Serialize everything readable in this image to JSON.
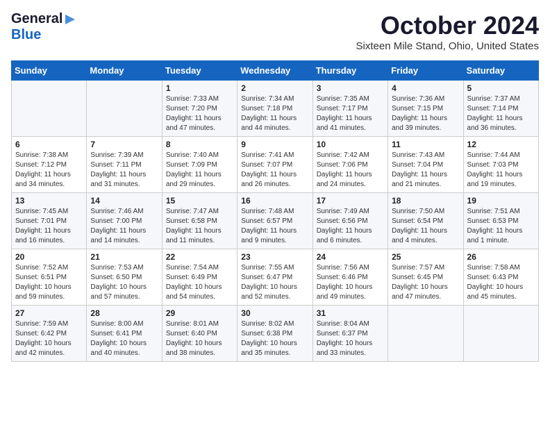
{
  "header": {
    "logo_general": "General",
    "logo_blue": "Blue",
    "calendar_title": "October 2024",
    "calendar_subtitle": "Sixteen Mile Stand, Ohio, United States"
  },
  "days_of_week": [
    "Sunday",
    "Monday",
    "Tuesday",
    "Wednesday",
    "Thursday",
    "Friday",
    "Saturday"
  ],
  "weeks": [
    [
      {
        "day": "",
        "sunrise": "",
        "sunset": "",
        "daylight": ""
      },
      {
        "day": "",
        "sunrise": "",
        "sunset": "",
        "daylight": ""
      },
      {
        "day": "1",
        "sunrise": "Sunrise: 7:33 AM",
        "sunset": "Sunset: 7:20 PM",
        "daylight": "Daylight: 11 hours and 47 minutes."
      },
      {
        "day": "2",
        "sunrise": "Sunrise: 7:34 AM",
        "sunset": "Sunset: 7:18 PM",
        "daylight": "Daylight: 11 hours and 44 minutes."
      },
      {
        "day": "3",
        "sunrise": "Sunrise: 7:35 AM",
        "sunset": "Sunset: 7:17 PM",
        "daylight": "Daylight: 11 hours and 41 minutes."
      },
      {
        "day": "4",
        "sunrise": "Sunrise: 7:36 AM",
        "sunset": "Sunset: 7:15 PM",
        "daylight": "Daylight: 11 hours and 39 minutes."
      },
      {
        "day": "5",
        "sunrise": "Sunrise: 7:37 AM",
        "sunset": "Sunset: 7:14 PM",
        "daylight": "Daylight: 11 hours and 36 minutes."
      }
    ],
    [
      {
        "day": "6",
        "sunrise": "Sunrise: 7:38 AM",
        "sunset": "Sunset: 7:12 PM",
        "daylight": "Daylight: 11 hours and 34 minutes."
      },
      {
        "day": "7",
        "sunrise": "Sunrise: 7:39 AM",
        "sunset": "Sunset: 7:11 PM",
        "daylight": "Daylight: 11 hours and 31 minutes."
      },
      {
        "day": "8",
        "sunrise": "Sunrise: 7:40 AM",
        "sunset": "Sunset: 7:09 PM",
        "daylight": "Daylight: 11 hours and 29 minutes."
      },
      {
        "day": "9",
        "sunrise": "Sunrise: 7:41 AM",
        "sunset": "Sunset: 7:07 PM",
        "daylight": "Daylight: 11 hours and 26 minutes."
      },
      {
        "day": "10",
        "sunrise": "Sunrise: 7:42 AM",
        "sunset": "Sunset: 7:06 PM",
        "daylight": "Daylight: 11 hours and 24 minutes."
      },
      {
        "day": "11",
        "sunrise": "Sunrise: 7:43 AM",
        "sunset": "Sunset: 7:04 PM",
        "daylight": "Daylight: 11 hours and 21 minutes."
      },
      {
        "day": "12",
        "sunrise": "Sunrise: 7:44 AM",
        "sunset": "Sunset: 7:03 PM",
        "daylight": "Daylight: 11 hours and 19 minutes."
      }
    ],
    [
      {
        "day": "13",
        "sunrise": "Sunrise: 7:45 AM",
        "sunset": "Sunset: 7:01 PM",
        "daylight": "Daylight: 11 hours and 16 minutes."
      },
      {
        "day": "14",
        "sunrise": "Sunrise: 7:46 AM",
        "sunset": "Sunset: 7:00 PM",
        "daylight": "Daylight: 11 hours and 14 minutes."
      },
      {
        "day": "15",
        "sunrise": "Sunrise: 7:47 AM",
        "sunset": "Sunset: 6:58 PM",
        "daylight": "Daylight: 11 hours and 11 minutes."
      },
      {
        "day": "16",
        "sunrise": "Sunrise: 7:48 AM",
        "sunset": "Sunset: 6:57 PM",
        "daylight": "Daylight: 11 hours and 9 minutes."
      },
      {
        "day": "17",
        "sunrise": "Sunrise: 7:49 AM",
        "sunset": "Sunset: 6:56 PM",
        "daylight": "Daylight: 11 hours and 6 minutes."
      },
      {
        "day": "18",
        "sunrise": "Sunrise: 7:50 AM",
        "sunset": "Sunset: 6:54 PM",
        "daylight": "Daylight: 11 hours and 4 minutes."
      },
      {
        "day": "19",
        "sunrise": "Sunrise: 7:51 AM",
        "sunset": "Sunset: 6:53 PM",
        "daylight": "Daylight: 11 hours and 1 minute."
      }
    ],
    [
      {
        "day": "20",
        "sunrise": "Sunrise: 7:52 AM",
        "sunset": "Sunset: 6:51 PM",
        "daylight": "Daylight: 10 hours and 59 minutes."
      },
      {
        "day": "21",
        "sunrise": "Sunrise: 7:53 AM",
        "sunset": "Sunset: 6:50 PM",
        "daylight": "Daylight: 10 hours and 57 minutes."
      },
      {
        "day": "22",
        "sunrise": "Sunrise: 7:54 AM",
        "sunset": "Sunset: 6:49 PM",
        "daylight": "Daylight: 10 hours and 54 minutes."
      },
      {
        "day": "23",
        "sunrise": "Sunrise: 7:55 AM",
        "sunset": "Sunset: 6:47 PM",
        "daylight": "Daylight: 10 hours and 52 minutes."
      },
      {
        "day": "24",
        "sunrise": "Sunrise: 7:56 AM",
        "sunset": "Sunset: 6:46 PM",
        "daylight": "Daylight: 10 hours and 49 minutes."
      },
      {
        "day": "25",
        "sunrise": "Sunrise: 7:57 AM",
        "sunset": "Sunset: 6:45 PM",
        "daylight": "Daylight: 10 hours and 47 minutes."
      },
      {
        "day": "26",
        "sunrise": "Sunrise: 7:58 AM",
        "sunset": "Sunset: 6:43 PM",
        "daylight": "Daylight: 10 hours and 45 minutes."
      }
    ],
    [
      {
        "day": "27",
        "sunrise": "Sunrise: 7:59 AM",
        "sunset": "Sunset: 6:42 PM",
        "daylight": "Daylight: 10 hours and 42 minutes."
      },
      {
        "day": "28",
        "sunrise": "Sunrise: 8:00 AM",
        "sunset": "Sunset: 6:41 PM",
        "daylight": "Daylight: 10 hours and 40 minutes."
      },
      {
        "day": "29",
        "sunrise": "Sunrise: 8:01 AM",
        "sunset": "Sunset: 6:40 PM",
        "daylight": "Daylight: 10 hours and 38 minutes."
      },
      {
        "day": "30",
        "sunrise": "Sunrise: 8:02 AM",
        "sunset": "Sunset: 6:38 PM",
        "daylight": "Daylight: 10 hours and 35 minutes."
      },
      {
        "day": "31",
        "sunrise": "Sunrise: 8:04 AM",
        "sunset": "Sunset: 6:37 PM",
        "daylight": "Daylight: 10 hours and 33 minutes."
      },
      {
        "day": "",
        "sunrise": "",
        "sunset": "",
        "daylight": ""
      },
      {
        "day": "",
        "sunrise": "",
        "sunset": "",
        "daylight": ""
      }
    ]
  ]
}
